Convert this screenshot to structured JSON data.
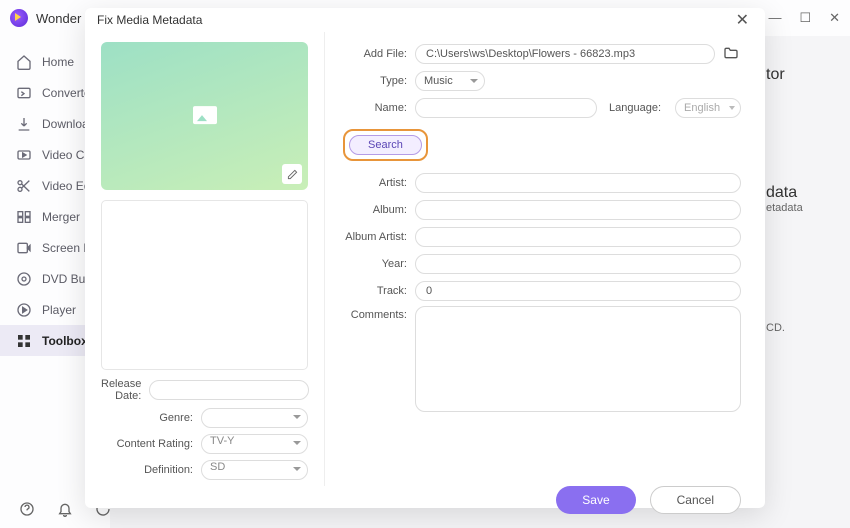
{
  "brand": "Wonder",
  "sidebar": {
    "items": [
      {
        "label": "Home"
      },
      {
        "label": "Converte"
      },
      {
        "label": "Downloa"
      },
      {
        "label": "Video Co"
      },
      {
        "label": "Video Ed"
      },
      {
        "label": "Merger"
      },
      {
        "label": "Screen R"
      },
      {
        "label": "DVD Bur"
      },
      {
        "label": "Player"
      },
      {
        "label": "Toolbox"
      }
    ]
  },
  "bg": {
    "t1": "tor",
    "t2": "data",
    "t3": "etadata",
    "t4": "CD."
  },
  "modal": {
    "title": "Fix Media Metadata",
    "addfile_label": "Add File:",
    "addfile_value": "C:\\Users\\ws\\Desktop\\Flowers - 66823.mp3",
    "type_label": "Type:",
    "type_value": "Music",
    "name_label": "Name:",
    "name_value": "",
    "language_label": "Language:",
    "language_value": "English",
    "search_label": "Search",
    "artist_label": "Artist:",
    "album_label": "Album:",
    "albumartist_label": "Album Artist:",
    "year_label": "Year:",
    "track_label": "Track:",
    "track_value": "0",
    "comments_label": "Comments:",
    "left": {
      "release_label": "Release Date:",
      "release_value": "",
      "genre_label": "Genre:",
      "genre_value": "",
      "rating_label": "Content Rating:",
      "rating_value": "TV-Y",
      "definition_label": "Definition:",
      "definition_value": "SD"
    },
    "save": "Save",
    "cancel": "Cancel"
  }
}
